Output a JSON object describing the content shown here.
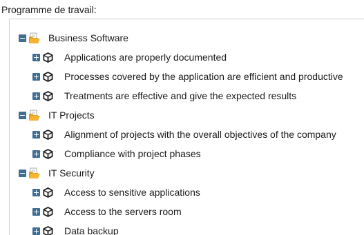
{
  "panel": {
    "label": "Programme de travail:"
  },
  "tree": [
    {
      "label": "Business Software",
      "icon": "open-folder-icon",
      "toggle": "collapse",
      "children": [
        {
          "label": "Applications are properly documented",
          "icon": "cube-icon",
          "toggle": "expand"
        },
        {
          "label": "Processes covered by the application are efficient and productive",
          "icon": "cube-icon",
          "toggle": "expand"
        },
        {
          "label": "Treatments are effective and give the expected results",
          "icon": "cube-icon",
          "toggle": "expand"
        }
      ]
    },
    {
      "label": "IT Projects",
      "icon": "open-folder-icon",
      "toggle": "collapse",
      "children": [
        {
          "label": "Alignment of projects with the overall objectives of the company",
          "icon": "cube-icon",
          "toggle": "expand"
        },
        {
          "label": "Compliance with project phases",
          "icon": "cube-icon",
          "toggle": "expand"
        }
      ]
    },
    {
      "label": "IT Security",
      "icon": "open-folder-icon",
      "toggle": "collapse",
      "children": [
        {
          "label": "Access to sensitive applications",
          "icon": "cube-icon",
          "toggle": "expand"
        },
        {
          "label": "Access to the servers room",
          "icon": "cube-icon",
          "toggle": "expand"
        },
        {
          "label": "Data backup",
          "icon": "cube-icon",
          "toggle": "expand"
        }
      ]
    }
  ],
  "colors": {
    "toggle": "#3f6d94",
    "folder_front": "#f5b432",
    "folder_back": "#e0a02a",
    "folder_paper": "#ffffff",
    "cube": "#1c1c1c"
  }
}
